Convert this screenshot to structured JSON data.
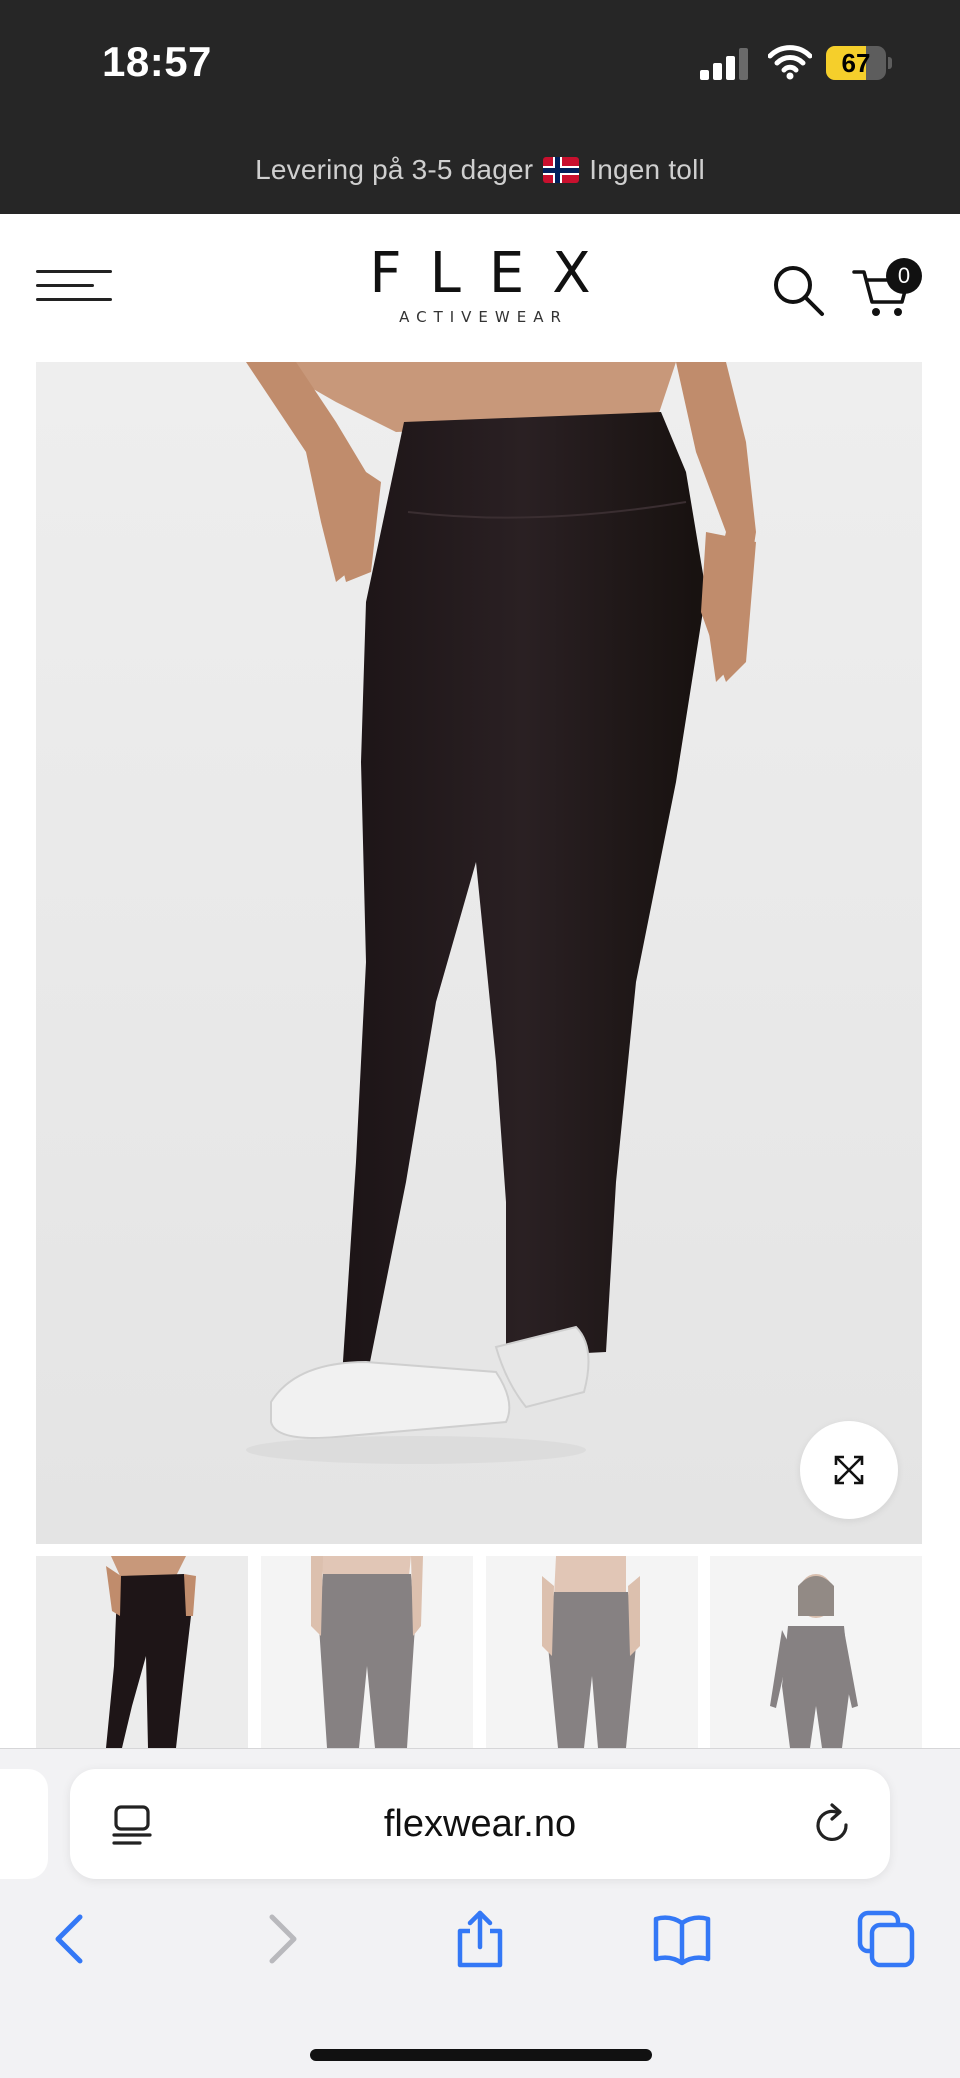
{
  "status_bar": {
    "time": "18:57",
    "battery_level": "67",
    "battery_fraction": 0.67,
    "signal_icon": "cellular-signal-icon",
    "wifi_icon": "wifi-icon",
    "battery_color": "#f5cf2b"
  },
  "announcement": {
    "text_before": "Levering på 3-5 dager",
    "flag_icon": "norway-flag-icon",
    "text_after": "Ingen toll"
  },
  "header": {
    "menu_icon": "hamburger-menu-icon",
    "logo_main": "FLEX",
    "logo_sub": "ACTIVEWEAR",
    "search_icon": "search-icon",
    "cart_icon": "cart-icon",
    "cart_count": "0"
  },
  "product": {
    "main_image": "product-photo",
    "expand_icon": "expand-icon",
    "thumbnails": [
      {
        "name": "thumbnail-front",
        "active": true
      },
      {
        "name": "thumbnail-back-1",
        "active": false
      },
      {
        "name": "thumbnail-back-2",
        "active": false
      },
      {
        "name": "thumbnail-full-outfit",
        "active": false
      }
    ]
  },
  "browser": {
    "url": "flexwear.no",
    "reader_icon": "reader-mode-icon",
    "reload_icon": "reload-icon",
    "back_icon": "back-arrow-icon",
    "forward_icon": "forward-arrow-icon",
    "share_icon": "share-icon",
    "bookmarks_icon": "bookmarks-icon",
    "tabs_icon": "tabs-icon",
    "accent_color": "#3478f6"
  }
}
